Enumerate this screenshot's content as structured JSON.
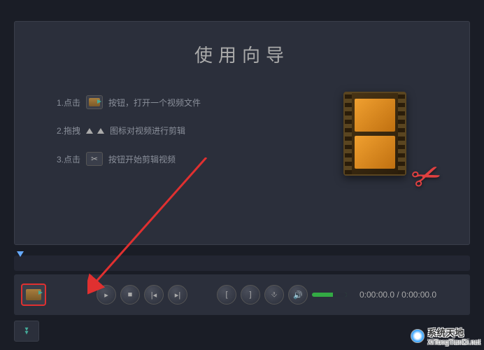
{
  "guide": {
    "title": "使用向导",
    "step1_prefix": "1.点击",
    "step1_suffix": "按钮，打开一个视频文件",
    "step2_prefix": "2.拖拽",
    "step2_suffix": "图标对视频进行剪辑",
    "step3_prefix": "3.点击",
    "step3_suffix": "按钮开始剪辑视频"
  },
  "controls": {
    "time_current": "0:00:00.0",
    "time_total": "0:00:00.0",
    "time_sep": " / "
  },
  "watermark": {
    "brand": "系统天地",
    "url": "XiTongTianDi.net"
  }
}
